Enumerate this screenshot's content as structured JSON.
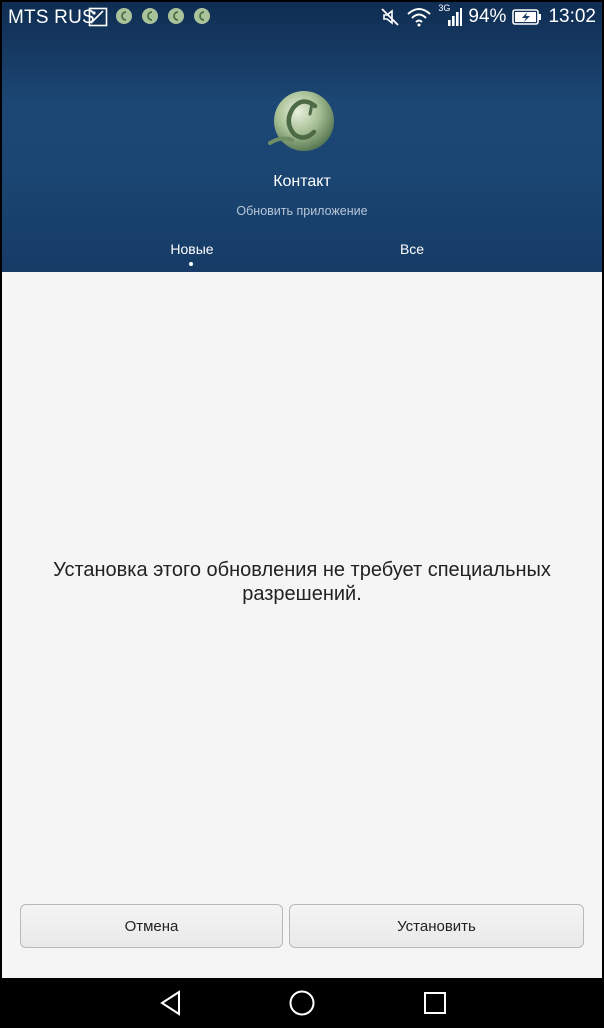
{
  "status_bar": {
    "carrier": "MTS RUS",
    "network": "3G",
    "battery": "94%",
    "time": "13:02",
    "icons": [
      "image-icon",
      "app-notification-icon",
      "app-notification-icon",
      "app-notification-icon",
      "app-notification-icon",
      "mute-icon",
      "wifi-icon",
      "signal-icon",
      "battery-charging-icon"
    ]
  },
  "header": {
    "app_name": "Контакт",
    "subtitle": "Обновить приложение",
    "tabs": [
      {
        "label": "Новые",
        "selected": true
      },
      {
        "label": "Все",
        "selected": false
      }
    ]
  },
  "main": {
    "message": "Установка этого обновления не требует специальных разрешений."
  },
  "buttons": {
    "cancel": "Отмена",
    "install": "Установить"
  },
  "nav": {
    "icons": [
      "back-icon",
      "home-icon",
      "recent-apps-icon"
    ]
  },
  "colors": {
    "header_bg": "#1c4774",
    "content_bg": "#f5f5f5"
  }
}
